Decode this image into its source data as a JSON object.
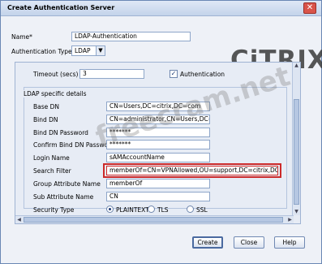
{
  "window": {
    "title": "Create Authentication Server"
  },
  "form": {
    "name_label": "Name*",
    "name_value": "LDAP-Authentication",
    "auth_type_label": "Authentication Type",
    "auth_type_value": "LDAP"
  },
  "panel": {
    "timeout_label": "Timeout (secs)",
    "timeout_value": "3",
    "authentication_label": "Authentication",
    "authentication_checked": true,
    "ldap_section_label": "LDAP specific details",
    "fields": [
      {
        "label": "Base DN",
        "value": "CN=Users,DC=citrix,DC=com"
      },
      {
        "label": "Bind DN",
        "value": "CN=administrator,CN=Users,DC=citrix,DC=com"
      },
      {
        "label": "Bind DN Password",
        "value": "*******"
      },
      {
        "label": "Confirm Bind DN Password",
        "value": "*******"
      },
      {
        "label": "Login Name",
        "value": "sAMAccountName"
      },
      {
        "label": "Search Filter",
        "value": "memberOf=CN=VPNAllowed,OU=support,DC=citrix,DC=com"
      },
      {
        "label": "Group Attribute Name",
        "value": "memberOf"
      },
      {
        "label": "Sub Attribute Name",
        "value": "CN"
      }
    ],
    "security_type_label": "Security Type",
    "security_options": [
      "PLAINTEXT",
      "TLS",
      "SSL"
    ],
    "security_selected": "PLAINTEXT"
  },
  "buttons": {
    "create": "Create",
    "close": "Close",
    "help": "Help"
  },
  "logo_text": "CiTRIX",
  "watermark_text": "freecram.net"
}
